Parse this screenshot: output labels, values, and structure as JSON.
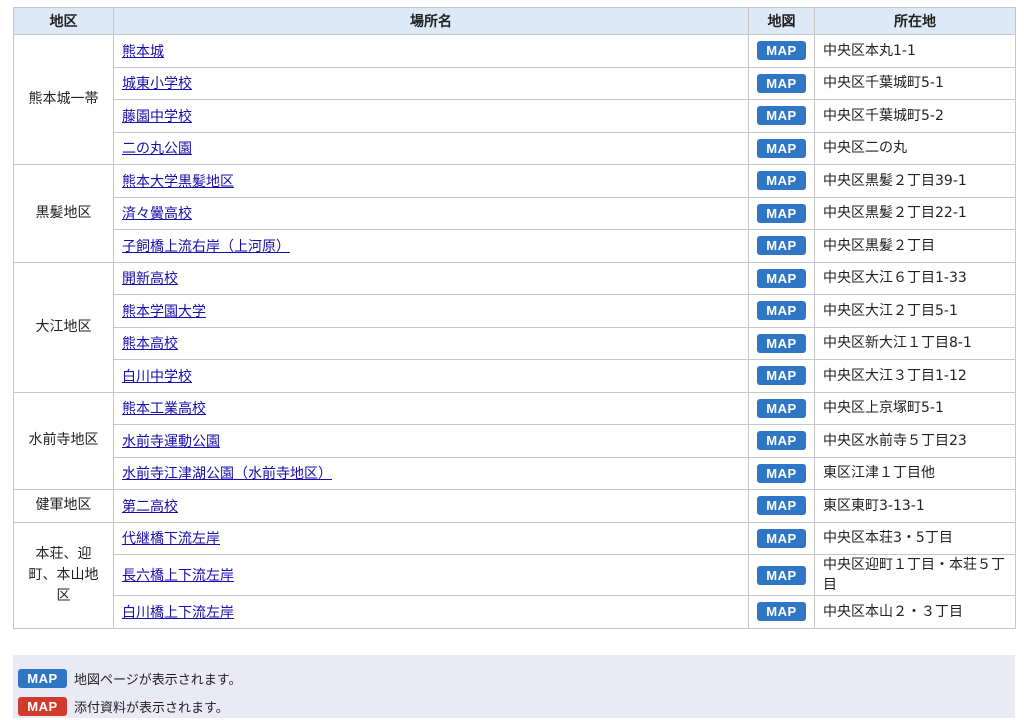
{
  "colors": {
    "map_blue": "#2f77c5",
    "doc_red": "#d13b2c",
    "header_bg": "#dde9f6"
  },
  "table": {
    "headers": {
      "district": "地区",
      "place": "場所名",
      "map": "地図",
      "address": "所在地"
    },
    "districts": [
      {
        "name": "熊本城一帯",
        "rows": [
          {
            "place": "熊本城",
            "map": "MAP",
            "address": "中央区本丸1-1"
          },
          {
            "place": "城東小学校",
            "map": "MAP",
            "address": "中央区千葉城町5-1"
          },
          {
            "place": "藤園中学校",
            "map": "MAP",
            "address": "中央区千葉城町5-2"
          },
          {
            "place": "二の丸公園",
            "map": "MAP",
            "address": "中央区二の丸"
          }
        ]
      },
      {
        "name": "黒髪地区",
        "rows": [
          {
            "place": "熊本大学黒髪地区",
            "map": "MAP",
            "address": "中央区黒髪２丁目39-1"
          },
          {
            "place": "済々黌高校",
            "map": "MAP",
            "address": "中央区黒髪２丁目22-1"
          },
          {
            "place": "子飼橋上流右岸（上河原）",
            "map": "MAP",
            "address": "中央区黒髪２丁目"
          }
        ]
      },
      {
        "name": "大江地区",
        "rows": [
          {
            "place": "開新高校",
            "map": "MAP",
            "address": "中央区大江６丁目1-33"
          },
          {
            "place": "熊本学園大学",
            "map": "MAP",
            "address": "中央区大江２丁目5-1"
          },
          {
            "place": "熊本高校",
            "map": "MAP",
            "address": "中央区新大江１丁目8-1"
          },
          {
            "place": "白川中学校",
            "map": "MAP",
            "address": "中央区大江３丁目1-12"
          }
        ]
      },
      {
        "name": "水前寺地区",
        "rows": [
          {
            "place": "熊本工業高校",
            "map": "MAP",
            "address": "中央区上京塚町5-1"
          },
          {
            "place": "水前寺運動公園",
            "map": "MAP",
            "address": "中央区水前寺５丁目23"
          },
          {
            "place": "水前寺江津湖公園（水前寺地区）",
            "map": "MAP",
            "address": "東区江津１丁目他"
          }
        ]
      },
      {
        "name": "健軍地区",
        "rows": [
          {
            "place": "第二高校",
            "map": "MAP",
            "address": "東区東町3-13-1"
          }
        ]
      },
      {
        "name": "本荘、迎町、本山地区",
        "rows": [
          {
            "place": "代継橋下流左岸",
            "map": "MAP",
            "address": "中央区本荘3・5丁目"
          },
          {
            "place": "長六橋上下流左岸",
            "map": "MAP",
            "address": "中央区迎町１丁目・本荘５丁目"
          },
          {
            "place": "白川橋上下流左岸",
            "map": "MAP",
            "address": "中央区本山２・３丁目"
          }
        ]
      }
    ]
  },
  "legend": [
    {
      "badge": "MAP",
      "text": "地図ページが表示されます。",
      "color": "#2f77c5"
    },
    {
      "badge": "MAP",
      "text": "添付資料が表示されます。",
      "color": "#d13b2c"
    }
  ]
}
